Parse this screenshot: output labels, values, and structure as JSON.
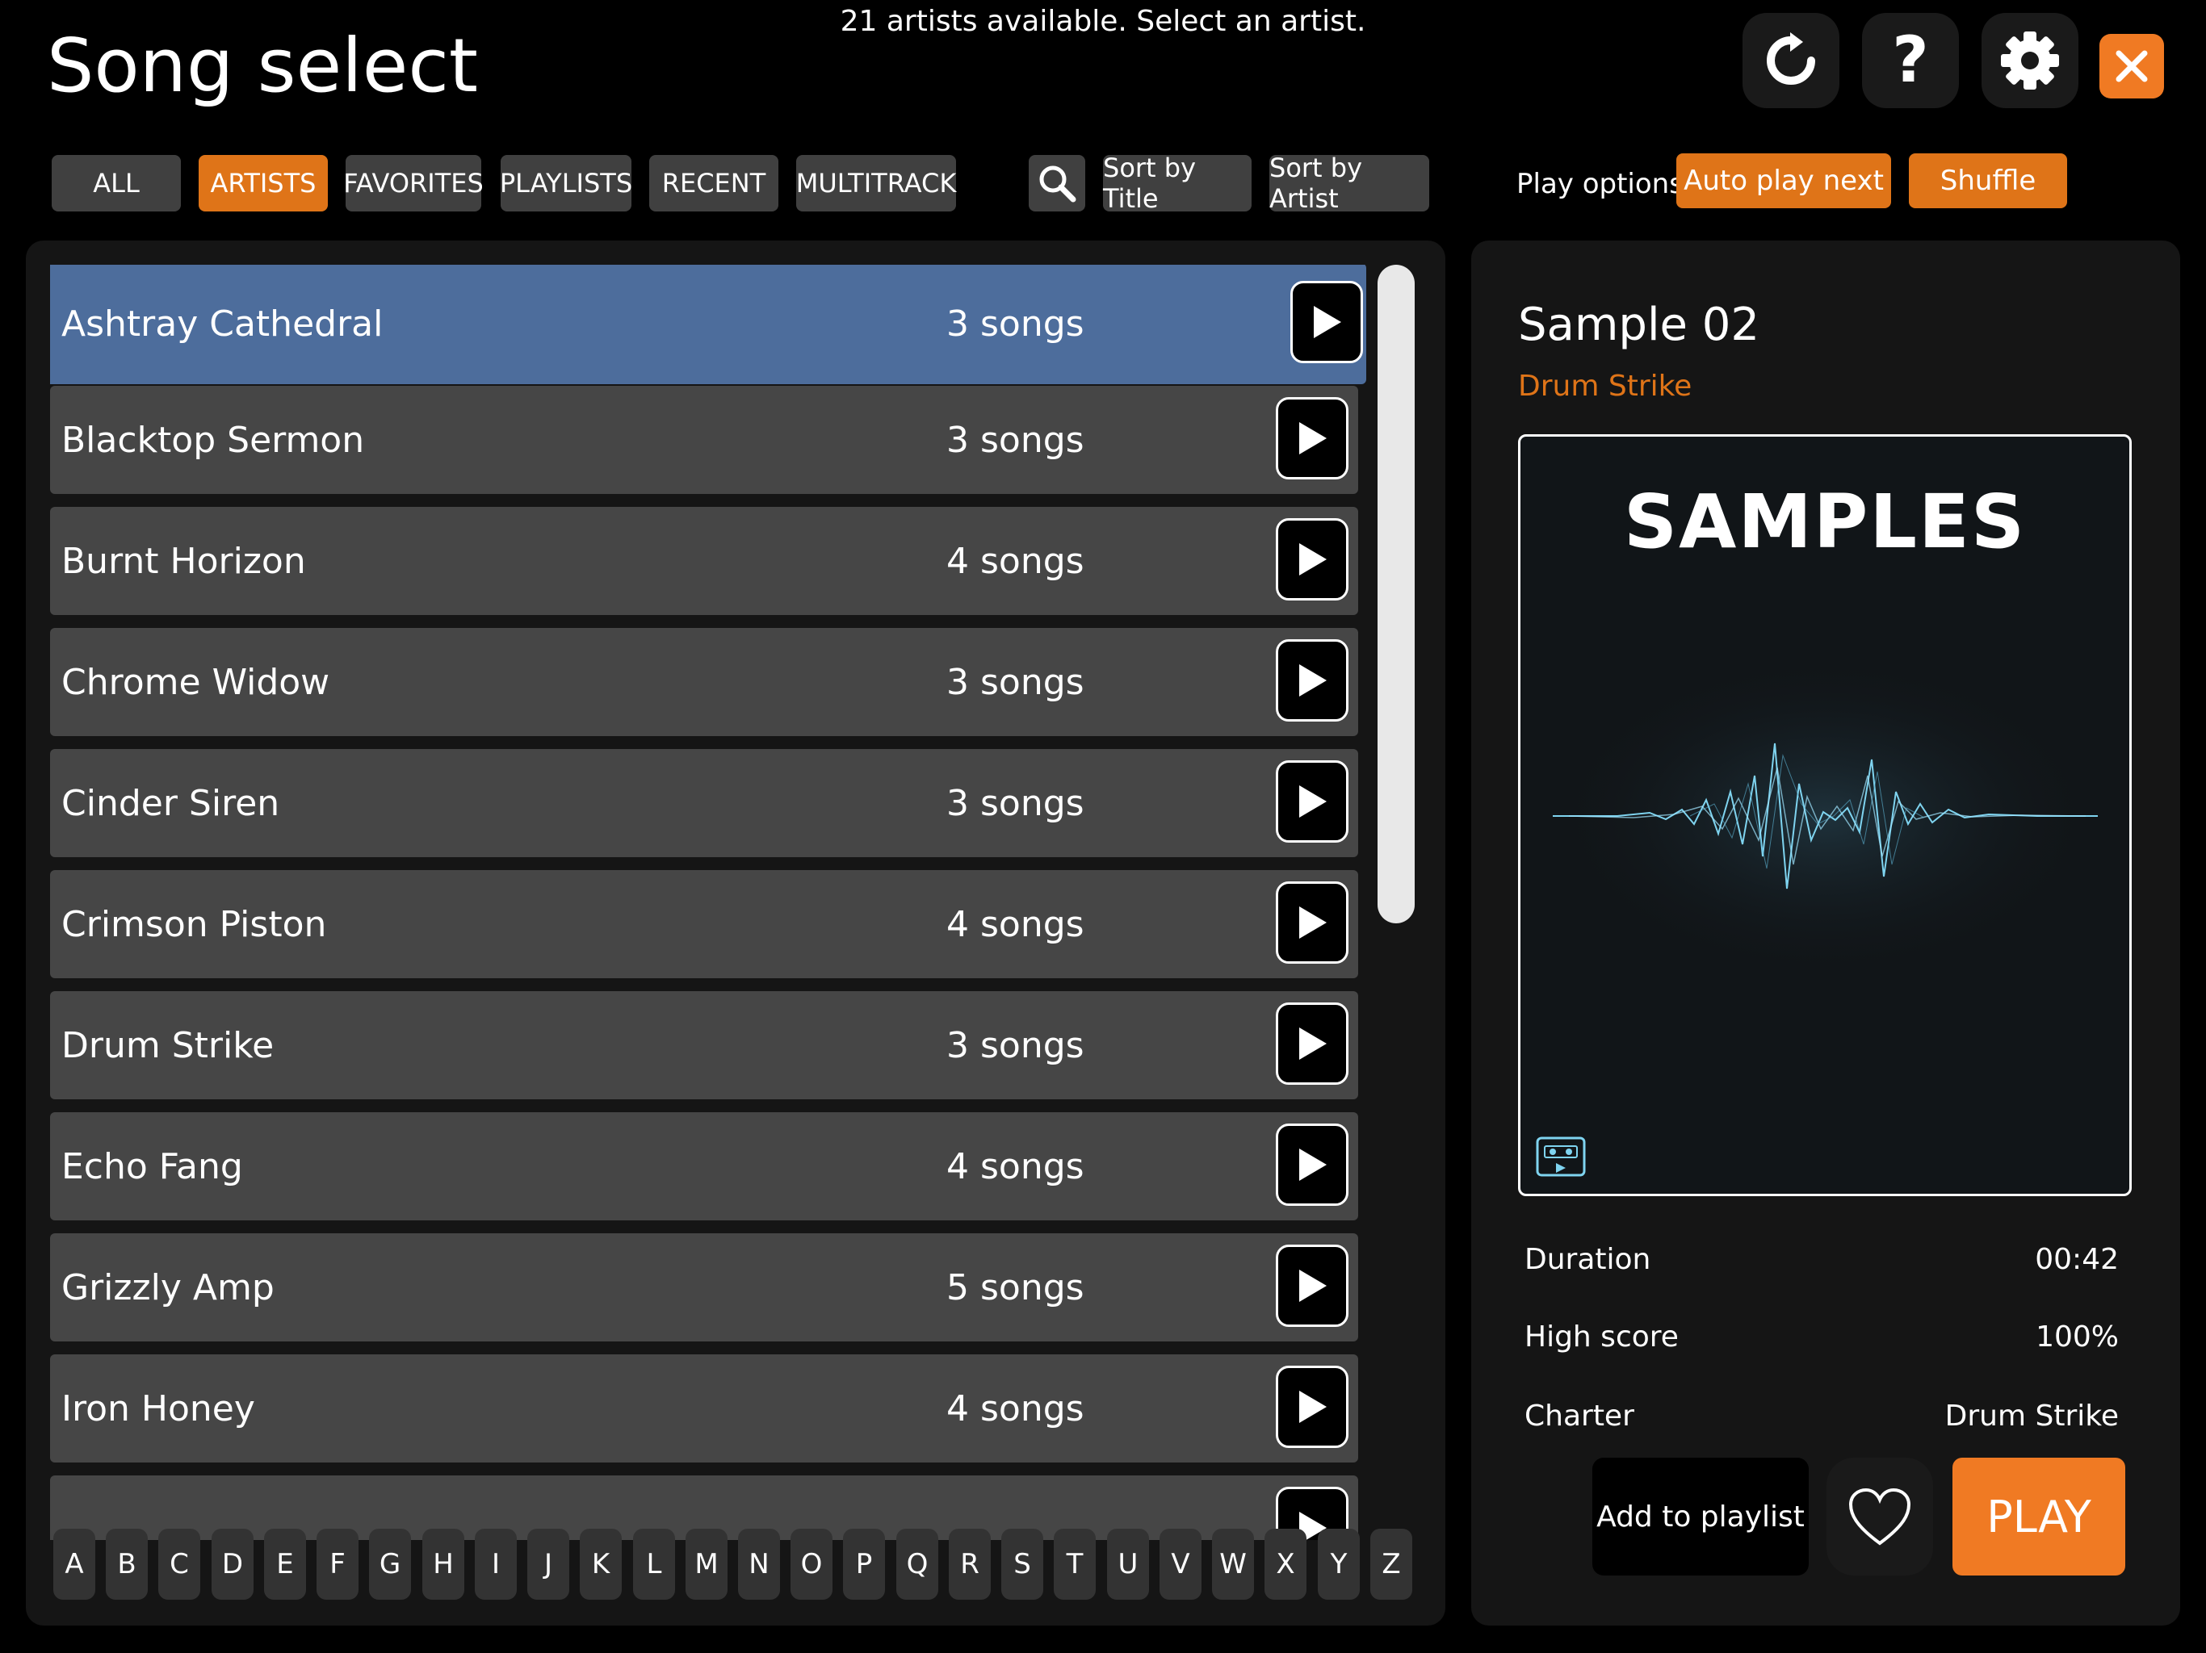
{
  "header": {
    "title": "Song select",
    "status": "21 artists available. Select an artist."
  },
  "tabs": [
    {
      "label": "ALL",
      "active": false
    },
    {
      "label": "ARTISTS",
      "active": true
    },
    {
      "label": "FAVORITES",
      "active": false
    },
    {
      "label": "PLAYLISTS",
      "active": false
    },
    {
      "label": "RECENT",
      "active": false
    },
    {
      "label": "MULTITRACK",
      "active": false
    }
  ],
  "sort": {
    "by_title": "Sort by Title",
    "by_artist": "Sort by Artist"
  },
  "play_options": {
    "label": "Play options :",
    "auto_play_next": "Auto play next",
    "shuffle": "Shuffle"
  },
  "artists": [
    {
      "name": "Ashtray Cathedral",
      "count": "3 songs",
      "selected": true
    },
    {
      "name": "Blacktop Sermon",
      "count": "3 songs",
      "selected": false
    },
    {
      "name": "Burnt Horizon",
      "count": "4 songs",
      "selected": false
    },
    {
      "name": "Chrome Widow",
      "count": "3 songs",
      "selected": false
    },
    {
      "name": "Cinder Siren",
      "count": "3 songs",
      "selected": false
    },
    {
      "name": "Crimson Piston",
      "count": "4 songs",
      "selected": false
    },
    {
      "name": "Drum Strike",
      "count": "3 songs",
      "selected": false
    },
    {
      "name": "Echo Fang",
      "count": "4 songs",
      "selected": false
    },
    {
      "name": "Grizzly Amp",
      "count": "5 songs",
      "selected": false
    },
    {
      "name": "Iron Honey",
      "count": "4 songs",
      "selected": false
    }
  ],
  "alphabet": [
    "A",
    "B",
    "C",
    "D",
    "E",
    "F",
    "G",
    "H",
    "I",
    "J",
    "K",
    "L",
    "M",
    "N",
    "O",
    "P",
    "Q",
    "R",
    "S",
    "T",
    "U",
    "V",
    "W",
    "X",
    "Y",
    "Z"
  ],
  "detail": {
    "song_title": "Sample 02",
    "artist": "Drum Strike",
    "cover_text": "SAMPLES",
    "duration_label": "Duration",
    "duration_value": "00:42",
    "highscore_label": "High score",
    "highscore_value": "100%",
    "charter_label": "Charter",
    "charter_value": "Drum Strike",
    "add_to_playlist": "Add to playlist",
    "play": "PLAY"
  },
  "colors": {
    "accent": "#df7418",
    "selected_row": "#4d6d9c",
    "waveform": "#7fd4f0"
  }
}
